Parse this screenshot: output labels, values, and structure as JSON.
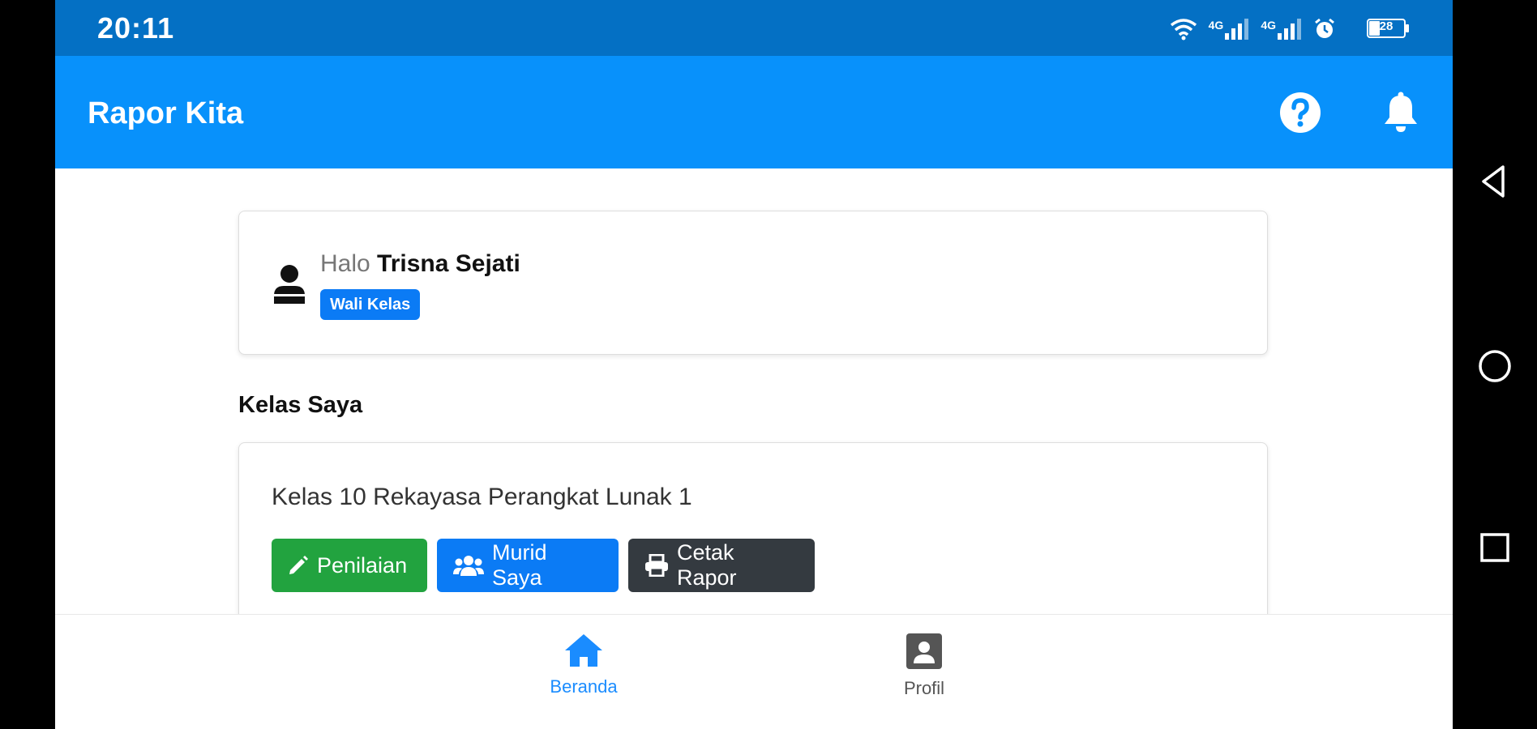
{
  "status_bar": {
    "time": "20:11",
    "icons": [
      "wifi-icon",
      "signal-4g-icon",
      "signal-4g-icon",
      "alarm-icon",
      "battery-icon"
    ],
    "net_label_1": "4G",
    "net_label_2": "4G",
    "battery_level": "28"
  },
  "app_bar": {
    "title": "Rapor Kita",
    "actions": [
      "help-icon",
      "bell-icon"
    ]
  },
  "greeting": {
    "prefix": "Halo",
    "name": "Trisna Sejati",
    "role_badge": "Wali Kelas"
  },
  "my_classes": {
    "section_title": "Kelas Saya",
    "classes": [
      {
        "name": "Kelas 10 Rekayasa Perangkat Lunak 1",
        "buttons": [
          {
            "label": "Penilaian",
            "icon": "pencil-icon"
          },
          {
            "label": "Murid Saya",
            "icon": "users-icon"
          },
          {
            "label": "Cetak Rapor",
            "icon": "printer-icon"
          }
        ]
      }
    ]
  },
  "bottom_nav": {
    "items": [
      {
        "label": "Beranda",
        "icon": "home-icon",
        "active": true
      },
      {
        "label": "Profil",
        "icon": "profile-icon",
        "active": false
      }
    ]
  },
  "colors": {
    "status_bar": "#0470c4",
    "app_bar": "#0891fb",
    "primary": "#0b7bf5",
    "success": "#22a33f",
    "dark": "#343a40",
    "nav_active": "#1a8cff",
    "nav_inactive": "#555555"
  }
}
